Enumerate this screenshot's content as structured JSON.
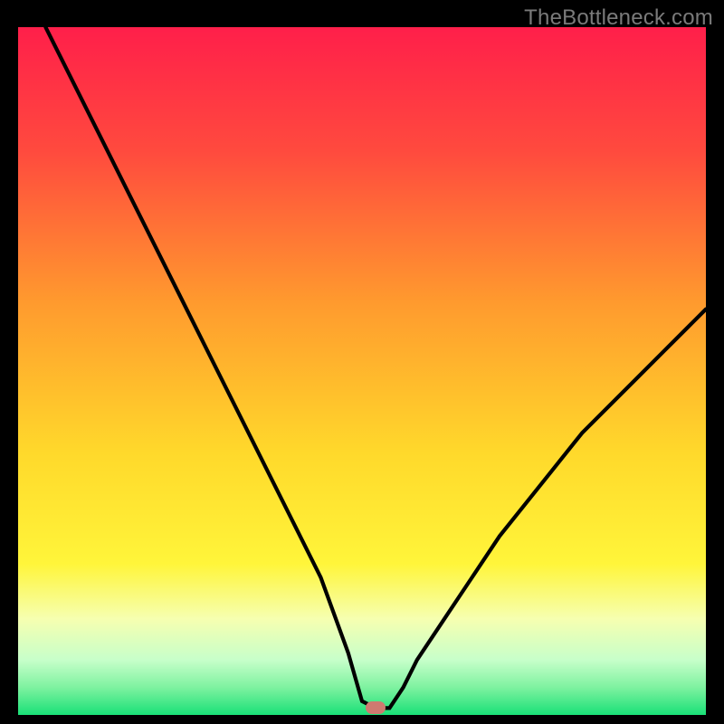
{
  "watermark": "TheBottleneck.com",
  "colors": {
    "frame": "#000000",
    "gradient_top": "#ff1f4a",
    "gradient_mid1": "#ff7a33",
    "gradient_mid2": "#ffe42b",
    "gradient_low1": "#f6ffb0",
    "gradient_low2": "#8ef2a3",
    "gradient_bottom": "#19e077",
    "curve": "#000000",
    "marker": "#cf7a70"
  },
  "chart_data": {
    "type": "line",
    "title": "",
    "xlabel": "",
    "ylabel": "",
    "xlim": [
      0,
      100
    ],
    "ylim": [
      0,
      100
    ],
    "series": [
      {
        "name": "bottleneck-curve",
        "x": [
          4,
          8,
          12,
          16,
          20,
          24,
          28,
          32,
          36,
          40,
          44,
          48,
          50,
          52,
          54,
          56,
          58,
          62,
          66,
          70,
          74,
          78,
          82,
          86,
          90,
          94,
          98,
          100
        ],
        "y": [
          100,
          92,
          84,
          76,
          68,
          60,
          52,
          44,
          36,
          28,
          20,
          9,
          2,
          1,
          1,
          4,
          8,
          14,
          20,
          26,
          31,
          36,
          41,
          45,
          49,
          53,
          57,
          59
        ]
      }
    ],
    "marker": {
      "x": 52,
      "y": 1
    },
    "annotations": []
  }
}
